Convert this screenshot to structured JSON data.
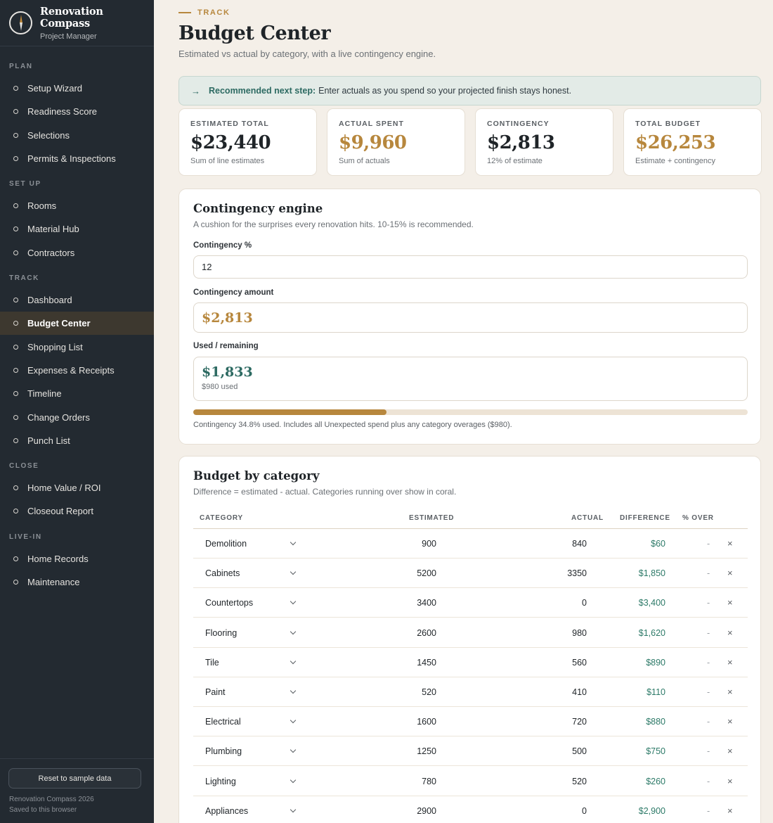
{
  "brand": {
    "title": "Renovation Compass",
    "subtitle": "Project Manager"
  },
  "nav": {
    "plan_label": "PLAN",
    "plan": [
      "Setup Wizard",
      "Readiness Score",
      "Selections",
      "Permits & Inspections"
    ],
    "setup_label": "SET UP",
    "setup": [
      "Rooms",
      "Material Hub",
      "Contractors"
    ],
    "track_label": "TRACK",
    "track": [
      "Dashboard",
      "Budget Center",
      "Shopping List",
      "Expenses & Receipts",
      "Timeline",
      "Change Orders",
      "Punch List"
    ],
    "close_label": "CLOSE",
    "close": [
      "Home Value / ROI",
      "Closeout Report"
    ],
    "livein_label": "LIVE-IN",
    "livein": [
      "Home Records",
      "Maintenance"
    ],
    "active": "Budget Center"
  },
  "footer": {
    "reset_label": "Reset to sample data",
    "line1": "Renovation Compass 2026",
    "line2": "Saved to this browser"
  },
  "header": {
    "eyebrow": "TRACK",
    "title": "Budget Center",
    "subtitle": "Estimated vs actual by category, with a live contingency engine."
  },
  "reco": {
    "strong": "Recommended next step:",
    "text": "Enter actuals as you spend so your projected finish stays honest."
  },
  "stats": [
    {
      "label": "ESTIMATED TOTAL",
      "value": "$23,440",
      "note": "Sum of line estimates",
      "color": "#1f2428"
    },
    {
      "label": "ACTUAL SPENT",
      "value": "$9,960",
      "note": "Sum of actuals",
      "color": "#b7873d"
    },
    {
      "label": "CONTINGENCY",
      "value": "$2,813",
      "note": "12% of estimate",
      "color": "#1f2428"
    },
    {
      "label": "TOTAL BUDGET",
      "value": "$26,253",
      "note": "Estimate + contingency",
      "color": "#b7873d"
    }
  ],
  "contingency": {
    "title": "Contingency engine",
    "subtitle": "A cushion for the surprises every renovation hits. 10-15% is recommended.",
    "pct_label": "Contingency %",
    "pct_value": "12",
    "amount_label": "Contingency amount",
    "amount_value": "$2,813",
    "used_label": "Used / remaining",
    "remaining_value": "$1,833",
    "used_note": "$980 used",
    "used_fraction": 0.348,
    "progress_note": "Contingency 34.8% used. Includes all Unexpected spend plus any category overages ($980)."
  },
  "budget": {
    "title": "Budget by category",
    "subtitle": "Difference = estimated - actual. Categories running over show in coral.",
    "columns": {
      "category": "CATEGORY",
      "estimated": "ESTIMATED",
      "actual": "ACTUAL",
      "difference": "DIFFERENCE",
      "over": "% OVER"
    },
    "rows": [
      {
        "category": "Demolition",
        "estimated": "900",
        "actual": "840",
        "difference": "$60",
        "over": "-"
      },
      {
        "category": "Cabinets",
        "estimated": "5200",
        "actual": "3350",
        "difference": "$1,850",
        "over": "-"
      },
      {
        "category": "Countertops",
        "estimated": "3400",
        "actual": "0",
        "difference": "$3,400",
        "over": "-"
      },
      {
        "category": "Flooring",
        "estimated": "2600",
        "actual": "980",
        "difference": "$1,620",
        "over": "-"
      },
      {
        "category": "Tile",
        "estimated": "1450",
        "actual": "560",
        "difference": "$890",
        "over": "-"
      },
      {
        "category": "Paint",
        "estimated": "520",
        "actual": "410",
        "difference": "$110",
        "over": "-"
      },
      {
        "category": "Electrical",
        "estimated": "1600",
        "actual": "720",
        "difference": "$880",
        "over": "-"
      },
      {
        "category": "Plumbing",
        "estimated": "1250",
        "actual": "500",
        "difference": "$750",
        "over": "-"
      },
      {
        "category": "Lighting",
        "estimated": "780",
        "actual": "520",
        "difference": "$260",
        "over": "-"
      },
      {
        "category": "Appliances",
        "estimated": "2900",
        "actual": "0",
        "difference": "$2,900",
        "over": "-"
      }
    ],
    "delete_glyph": "×"
  },
  "colors": {
    "accent": "#b7873d",
    "teal": "#2d6a62",
    "sidebar": "#232a31"
  }
}
